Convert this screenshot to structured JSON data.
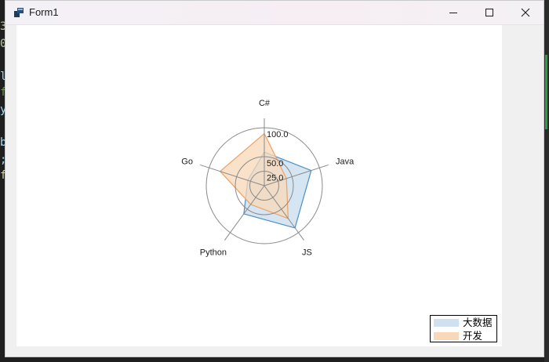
{
  "window": {
    "title": "Form1"
  },
  "background_code": {
    "lines": [
      "3",
      "0",
      "l",
      "fi",
      "y",
      "b",
      ";",
      "f"
    ]
  },
  "chart_data": {
    "type": "radar",
    "title": "",
    "categories": [
      "C#",
      "Java",
      "JS",
      "Python",
      "Go"
    ],
    "rlim": [
      0,
      100
    ],
    "ring_ticks": [
      25.0,
      50.0,
      100.0
    ],
    "ring_tick_labels": [
      "25.0",
      "50.0",
      "100.0"
    ],
    "series": [
      {
        "name": "大数据",
        "values": [
          58,
          85,
          90,
          60,
          30
        ],
        "stroke": "#4a8fc6",
        "fill": "#cfe1f0"
      },
      {
        "name": "开发",
        "values": [
          90,
          40,
          70,
          40,
          80
        ],
        "stroke": "#f0a060",
        "fill": "#f8d8b8"
      }
    ],
    "legend_position": "bottom-right",
    "grid": true
  },
  "colors": {
    "grid_line": "#8a8a8a",
    "overlap_fill": "#c4b5ad"
  }
}
